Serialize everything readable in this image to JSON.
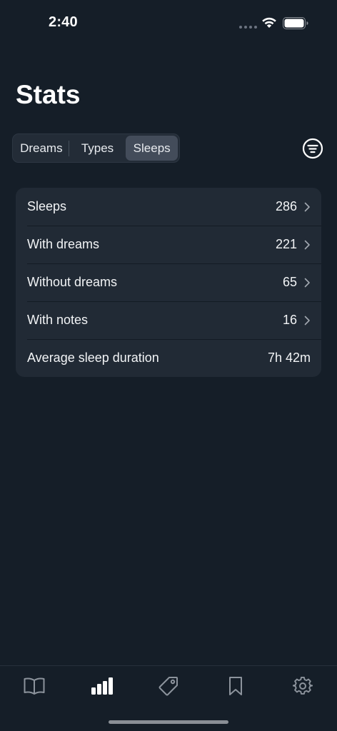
{
  "status_bar": {
    "time": "2:40"
  },
  "header": {
    "title": "Stats"
  },
  "segmented_control": {
    "segments": [
      {
        "label": "Dreams",
        "selected": false
      },
      {
        "label": "Types",
        "selected": false
      },
      {
        "label": "Sleeps",
        "selected": true
      }
    ]
  },
  "stats": {
    "rows": [
      {
        "label": "Sleeps",
        "value": "286",
        "has_chevron": true
      },
      {
        "label": "With dreams",
        "value": "221",
        "has_chevron": true
      },
      {
        "label": "Without dreams",
        "value": "65",
        "has_chevron": true
      },
      {
        "label": "With notes",
        "value": "16",
        "has_chevron": true
      },
      {
        "label": "Average sleep duration",
        "value": "7h 42m",
        "has_chevron": false
      }
    ]
  },
  "tab_bar": {
    "items": [
      {
        "icon": "book-icon",
        "selected": false
      },
      {
        "icon": "chart-bars-icon",
        "selected": true
      },
      {
        "icon": "tag-icon",
        "selected": false
      },
      {
        "icon": "bookmark-icon",
        "selected": false
      },
      {
        "icon": "gear-icon",
        "selected": false
      }
    ]
  },
  "colors": {
    "background": "#151e28",
    "card": "#212a35",
    "segment_selected": "#434c5a",
    "text": "#f2f4f6",
    "inactive_icon": "#8c939c"
  }
}
